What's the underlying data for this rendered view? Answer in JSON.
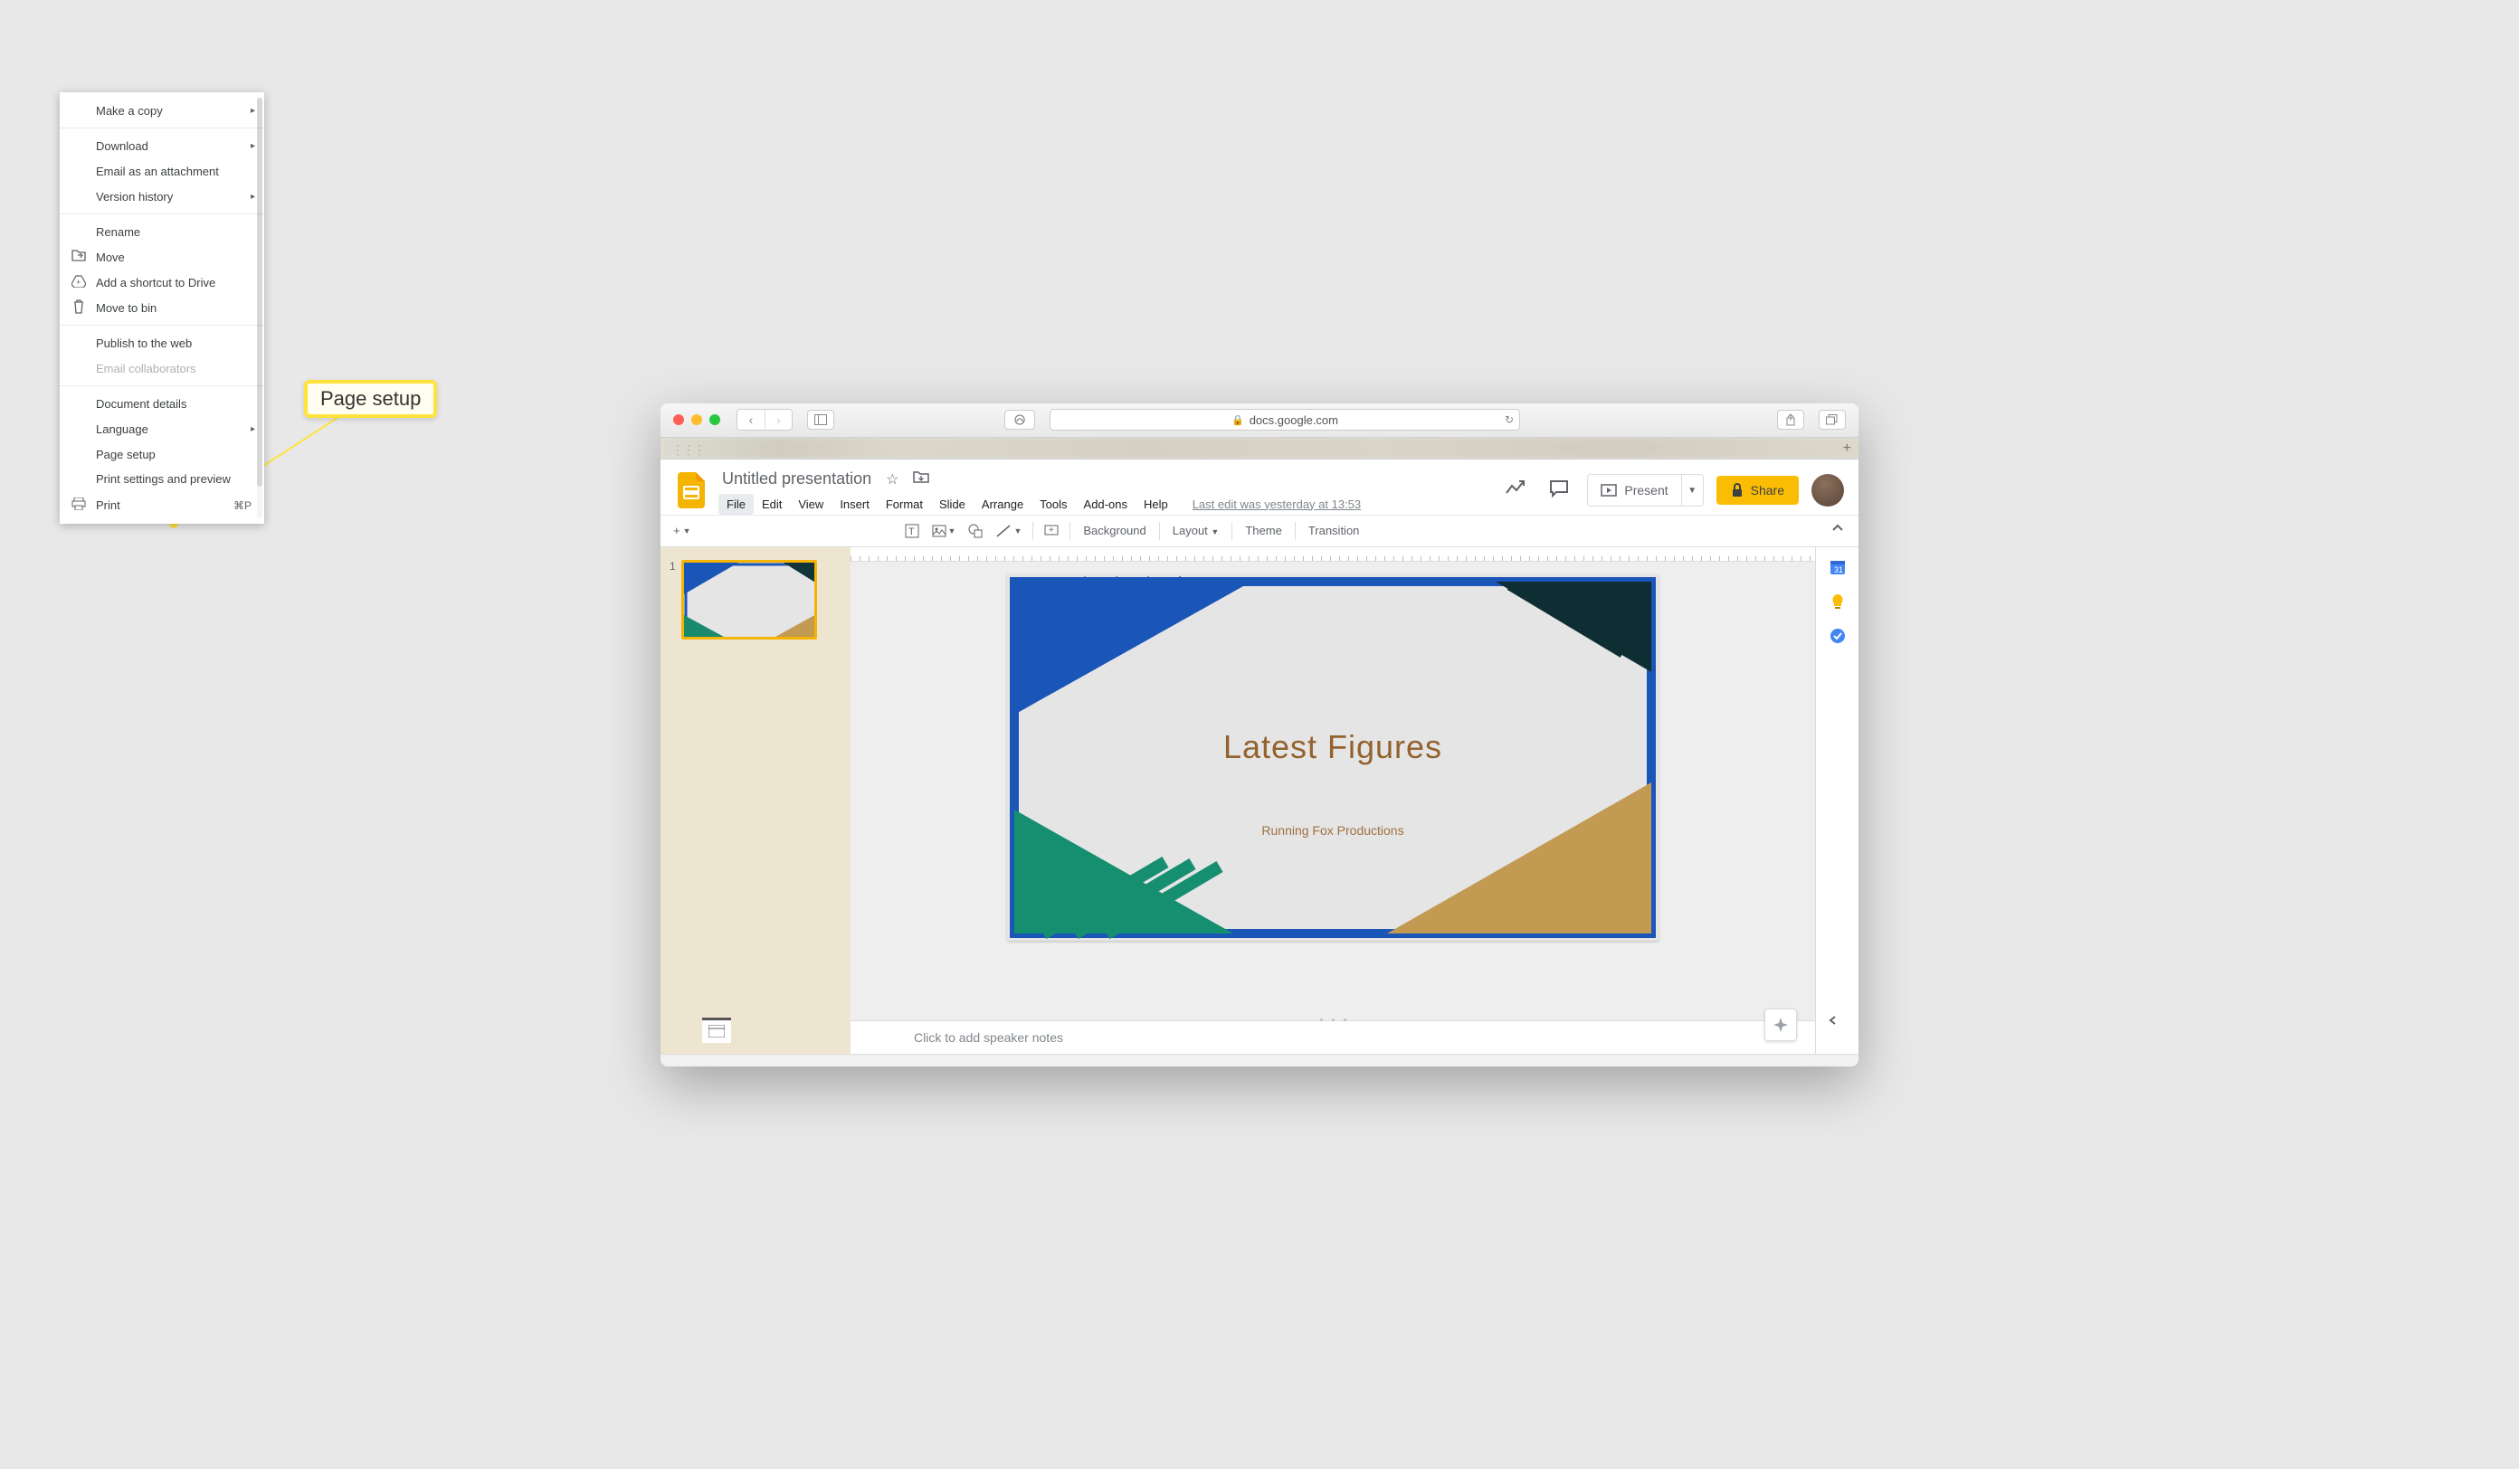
{
  "browser": {
    "url": "docs.google.com"
  },
  "header": {
    "title": "Untitled presentation",
    "last_edit": "Last edit was yesterday at 13:53",
    "present": "Present",
    "share": "Share"
  },
  "menu": [
    "File",
    "Edit",
    "View",
    "Insert",
    "Format",
    "Slide",
    "Arrange",
    "Tools",
    "Add-ons",
    "Help"
  ],
  "toolbar": {
    "background": "Background",
    "layout": "Layout",
    "theme": "Theme",
    "transition": "Transition"
  },
  "filmstrip": {
    "num": "1"
  },
  "slide": {
    "title": "Latest Figures",
    "subtitle": "Running Fox Productions"
  },
  "notes_placeholder": "Click to add speaker notes",
  "file_menu": {
    "make_copy": "Make a copy",
    "download": "Download",
    "email_attachment": "Email as an attachment",
    "version_history": "Version history",
    "rename": "Rename",
    "move": "Move",
    "add_shortcut": "Add a shortcut to Drive",
    "move_bin": "Move to bin",
    "publish": "Publish to the web",
    "email_collab": "Email collaborators",
    "doc_details": "Document details",
    "language": "Language",
    "page_setup": "Page setup",
    "print_preview": "Print settings and preview",
    "print": "Print",
    "print_shortcut": "⌘P"
  },
  "callout": {
    "text": "Page setup"
  }
}
